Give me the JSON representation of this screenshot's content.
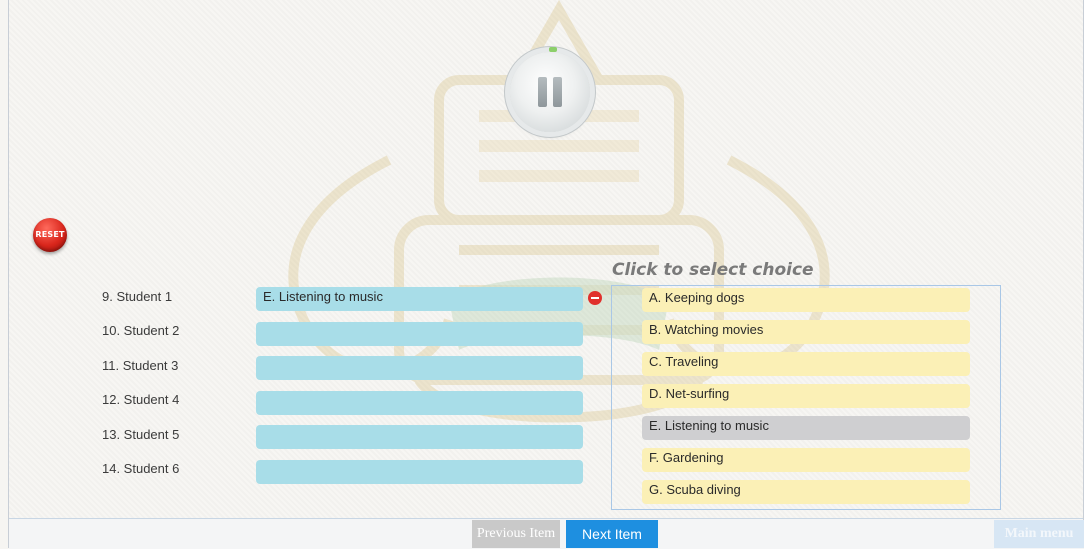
{
  "player": {
    "state": "paused",
    "progress": 0.02,
    "icon": "pause-icon"
  },
  "reset": {
    "label": "RESET"
  },
  "students": [
    {
      "label": "9. Student 1",
      "answer": "E. Listening to music"
    },
    {
      "label": "10. Student 2",
      "answer": ""
    },
    {
      "label": "11. Student 3",
      "answer": ""
    },
    {
      "label": "12. Student 4",
      "answer": ""
    },
    {
      "label": "13. Student 5",
      "answer": ""
    },
    {
      "label": "14. Student 6",
      "answer": ""
    }
  ],
  "choices": {
    "title": "Click to select choice",
    "items": [
      {
        "label": "A. Keeping dogs",
        "used": false
      },
      {
        "label": "B. Watching movies",
        "used": false
      },
      {
        "label": "C. Traveling",
        "used": false
      },
      {
        "label": "D. Net-surfing",
        "used": false
      },
      {
        "label": "E. Listening to music",
        "used": true
      },
      {
        "label": "F. Gardening",
        "used": false
      },
      {
        "label": "G. Scuba diving",
        "used": false
      }
    ]
  },
  "nav": {
    "previous": "Previous Item",
    "next": "Next Item",
    "main_menu": "Main menu"
  },
  "colors": {
    "slot": "#a8dde8",
    "choice": "#fbf0b6",
    "choice_used": "#cfcfd1",
    "next_button": "#1e8fe0",
    "reset": "#d9261c"
  }
}
